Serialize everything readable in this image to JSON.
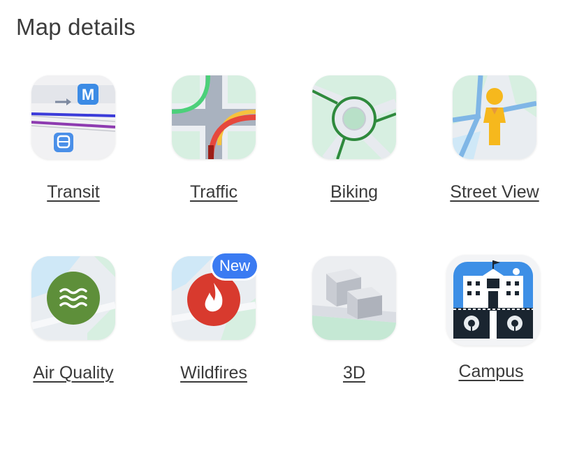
{
  "header": {
    "title": "Map details"
  },
  "layers": [
    {
      "label": "Transit",
      "icon": "transit-icon"
    },
    {
      "label": "Traffic",
      "icon": "traffic-icon"
    },
    {
      "label": "Biking",
      "icon": "biking-icon"
    },
    {
      "label": "Street View",
      "icon": "street-view-icon"
    },
    {
      "label": "Air Quality",
      "icon": "air-quality-icon"
    },
    {
      "label": "Wildfires",
      "icon": "wildfires-icon",
      "badge": "New"
    },
    {
      "label": "3D",
      "icon": "3d-icon"
    },
    {
      "label": "Campus",
      "icon": "campus-icon"
    }
  ],
  "colors": {
    "accent": "#3b7bf2",
    "text": "#3a3a3a"
  }
}
